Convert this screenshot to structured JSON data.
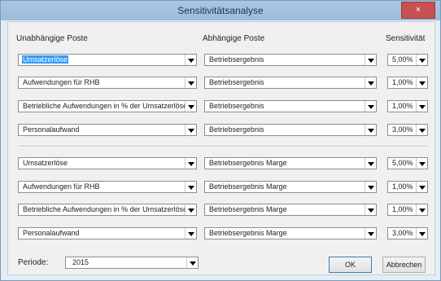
{
  "window": {
    "title": "Sensitivitätsanalyse",
    "close_glyph": "×"
  },
  "headers": {
    "independent": "Unabhängige Poste",
    "dependent": "Abhängige Poste",
    "sensitivity": "Sensitivität"
  },
  "group1": [
    {
      "independent": "Umsatzerlöse",
      "dependent": "Betriebsergebnis",
      "sensitivity": "5,00%"
    },
    {
      "independent": "Aufwendungen für RHB",
      "dependent": "Betriebsergebnis",
      "sensitivity": "1,00%"
    },
    {
      "independent": "Betriebliche Aufwendungen in % der Umsatzerlöse",
      "dependent": "Betriebsergebnis",
      "sensitivity": "1,00%"
    },
    {
      "independent": "Personalaufwand",
      "dependent": "Betriebsergebnis",
      "sensitivity": "3,00%"
    }
  ],
  "group2": [
    {
      "independent": "Umsatzerlöse",
      "dependent": "Betriebsergebnis Marge",
      "sensitivity": "5,00%"
    },
    {
      "independent": "Aufwendungen für RHB",
      "dependent": "Betriebsergebnis Marge",
      "sensitivity": "1,00%"
    },
    {
      "independent": "Betriebliche Aufwendungen in % der Umsatzerlöse",
      "dependent": "Betriebsergebnis Marge",
      "sensitivity": "1,00%"
    },
    {
      "independent": "Personalaufwand",
      "dependent": "Betriebsergebnis Marge",
      "sensitivity": "3,00%"
    }
  ],
  "period": {
    "label": "Periode:",
    "value": "2015"
  },
  "buttons": {
    "ok": "OK",
    "cancel": "Abbrechen"
  }
}
